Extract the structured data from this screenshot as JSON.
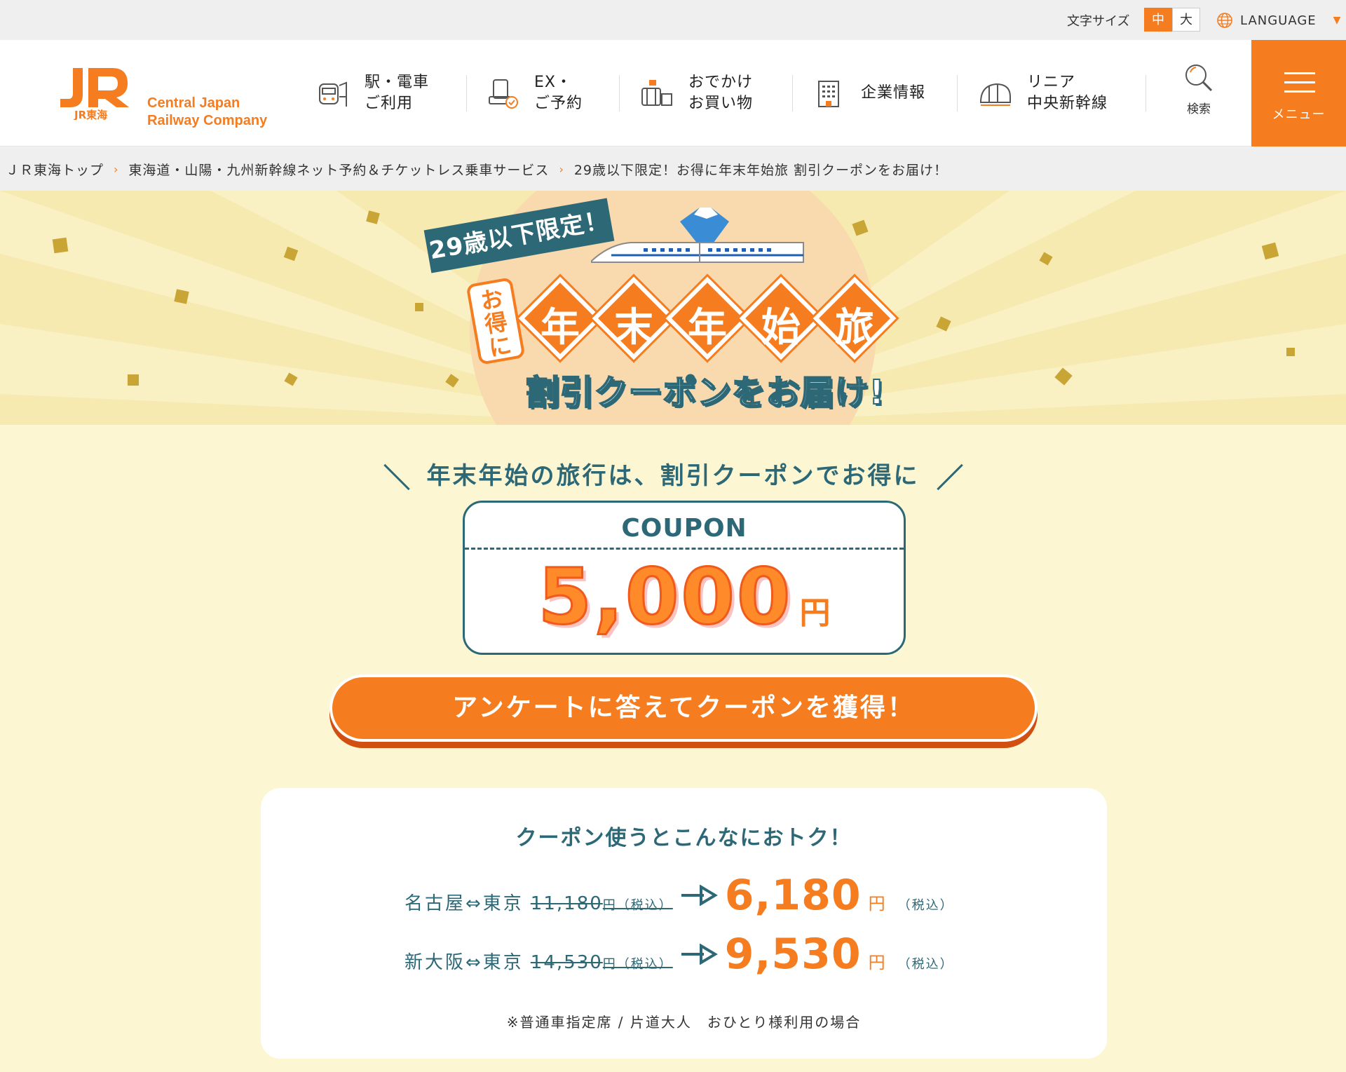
{
  "utility": {
    "font_size_label": "文字サイズ",
    "font_size_mid": "中",
    "font_size_large": "大",
    "language_label": "LANGUAGE"
  },
  "header": {
    "logo_text": "JR東海",
    "logo_en_line1": "Central Japan",
    "logo_en_line2": "Railway Company",
    "nav": [
      {
        "label": "駅・電車\nご利用",
        "icon": "train-icon"
      },
      {
        "label": "EX・\nご予約",
        "icon": "reservation-icon"
      },
      {
        "label": "おでかけ\nお買い物",
        "icon": "travel-shopping-icon"
      },
      {
        "label": "企業情報",
        "icon": "building-icon"
      },
      {
        "label": "リニア\n中央新幹線",
        "icon": "maglev-icon"
      }
    ],
    "search_label": "検索",
    "menu_label": "メニュー"
  },
  "breadcrumb": [
    "ＪＲ東海トップ",
    "東海道・山陽・九州新幹線ネット予約＆チケットレス乗車サービス",
    "29歳以下限定！お得に年末年始旅 割引クーポンをお届け！"
  ],
  "hero": {
    "badge": "29歳以下限定！",
    "otoku": "お得に",
    "kanji": [
      "年",
      "末",
      "年",
      "始",
      "旅"
    ],
    "subtitle": "割引クーポンをお届け!"
  },
  "main": {
    "lead": "年末年始の旅行は、割引クーポンでお得に",
    "coupon_title": "COUPON",
    "coupon_amount": "5,000",
    "coupon_yen": "円",
    "cta_label": "アンケートに答えてクーポンを獲得！"
  },
  "card": {
    "title": "クーポン使うとこんなにおトク！",
    "rows": [
      {
        "route": "名古屋⇔東京",
        "old_price": "11,180",
        "old_yen": "円（税込）",
        "new_price": "6,180",
        "new_yen": "円",
        "tax": "（税込）"
      },
      {
        "route": "新大阪⇔東京",
        "old_price": "14,530",
        "old_yen": "円（税込）",
        "new_price": "9,530",
        "new_yen": "円",
        "tax": "（税込）"
      }
    ],
    "note": "※普通車指定席 / 片道大人　おひとり様利用の場合"
  },
  "colors": {
    "accent": "#f57c1f",
    "teal": "#2d6877",
    "page_bg": "#fdf6d2",
    "hero_bg": "#f6eab0"
  }
}
